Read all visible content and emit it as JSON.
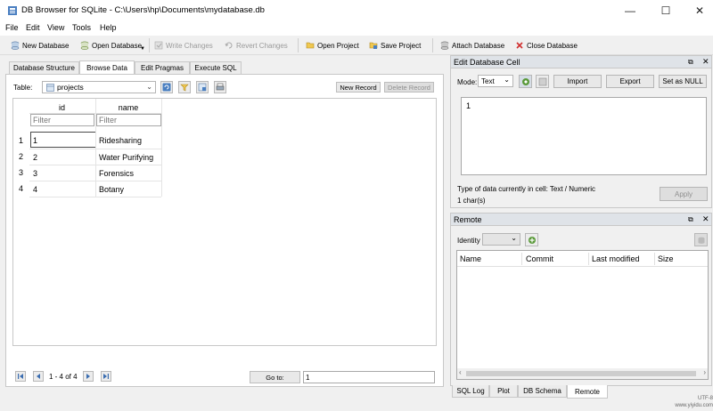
{
  "window": {
    "title": "DB Browser for SQLite - C:\\Users\\hp\\Documents\\mydatabase.db",
    "minimize": "—",
    "maximize": "☐",
    "close": "✕"
  },
  "menu": [
    "File",
    "Edit",
    "View",
    "Tools",
    "Help"
  ],
  "toolbar": {
    "new_database": "New Database",
    "open_database": "Open Database",
    "write_changes": "Write Changes",
    "revert_changes": "Revert Changes",
    "open_project": "Open Project",
    "save_project": "Save Project",
    "attach_database": "Attach Database",
    "close_database": "Close Database"
  },
  "tabs": [
    "Database Structure",
    "Browse Data",
    "Edit Pragmas",
    "Execute SQL"
  ],
  "browse": {
    "table_label": "Table:",
    "table_value": "projects",
    "new_record": "New Record",
    "delete_record": "Delete Record",
    "columns": [
      "id",
      "name"
    ],
    "filter_placeholder": "Filter",
    "rows": [
      {
        "num": "1",
        "id": "1",
        "name": "Ridesharing"
      },
      {
        "num": "2",
        "id": "2",
        "name": "Water Purifying"
      },
      {
        "num": "3",
        "id": "3",
        "name": "Forensics"
      },
      {
        "num": "4",
        "id": "4",
        "name": "Botany"
      }
    ],
    "pager_text": "1 - 4 of 4",
    "goto_label": "Go to:",
    "goto_value": "1"
  },
  "edit_cell": {
    "title": "Edit Database Cell",
    "mode_label": "Mode:",
    "mode_value": "Text",
    "import": "Import",
    "export": "Export",
    "set_null": "Set as NULL",
    "cell_value": "1",
    "type_info": "Type of data currently in cell: Text / Numeric",
    "size_info": "1 char(s)",
    "apply": "Apply"
  },
  "remote": {
    "title": "Remote",
    "identity_label": "Identity",
    "columns": [
      "Name",
      "Commit",
      "Last modified",
      "Size"
    ]
  },
  "bottom_tabs": [
    "SQL Log",
    "Plot",
    "DB Schema",
    "Remote"
  ],
  "watermark": "UTF-8\nwww.yiyidu.com"
}
